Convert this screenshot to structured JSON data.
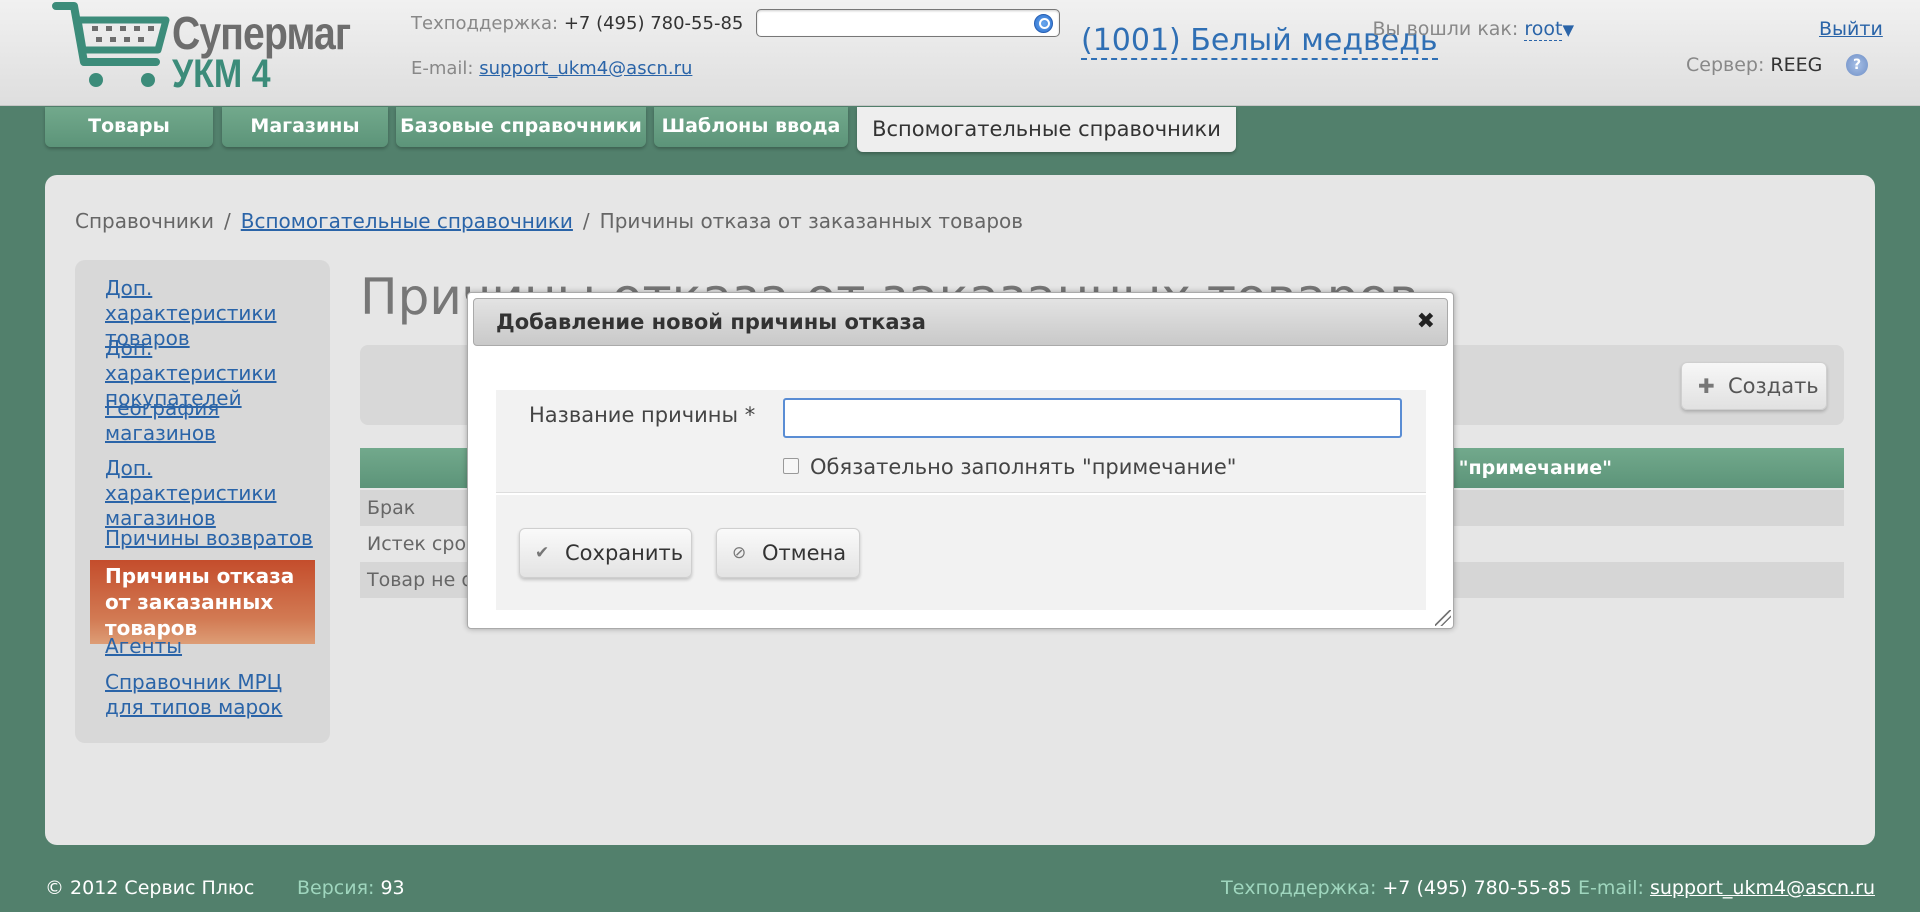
{
  "header": {
    "logo": {
      "line1": "Супермаг",
      "line2": "УКМ 4"
    },
    "support_label": "Техподдержка:",
    "support_phone": "+7 (495) 780-55-85",
    "email_label": "E-mail:",
    "email": "support_ukm4@ascn.ru",
    "search": {
      "value": "",
      "placeholder": ""
    },
    "shop": "(1001) Белый медведь",
    "logged_in_label": "Вы вошли как:",
    "user": "root",
    "logout": "Выйти",
    "server_label": "Сервер:",
    "server": "REEG",
    "help": "?"
  },
  "tabs": [
    {
      "label": "Товары"
    },
    {
      "label": "Магазины"
    },
    {
      "label": "Базовые справочники"
    },
    {
      "label": "Шаблоны ввода"
    },
    {
      "label": "Вспомогательные справочники",
      "active": true
    }
  ],
  "breadcrumb": {
    "root": "Справочники",
    "sep": "/",
    "parent": "Вспомогательные справочники",
    "current": "Причины отказа от заказанных товаров"
  },
  "sidebar": {
    "items": [
      {
        "label": "Доп. характеристики товаров"
      },
      {
        "label": "Доп. характеристики покупателей"
      },
      {
        "label": "География магазинов"
      },
      {
        "label": "Доп. характеристики магазинов"
      },
      {
        "label": "Причины возвратов"
      },
      {
        "label": "Причины отказа от заказанных товаров",
        "active": true
      },
      {
        "label": "Агенты"
      },
      {
        "label": "Справочник МРЦ для типов марок"
      }
    ]
  },
  "main": {
    "title": "Причины отказа от заказанных товаров",
    "create_button": "Создать",
    "grid": {
      "header_visible": "ь \"примечание\"",
      "rows": [
        "Брак",
        "Истек срок",
        "Товар не о"
      ]
    }
  },
  "dialog": {
    "title": "Добавление новой причины отказа",
    "close": "✖",
    "name_label": "Название причины *",
    "name_value": "",
    "checkbox_label": "Обязательно заполнять \"примечание\"",
    "checkbox_checked": false,
    "save": "Сохранить",
    "cancel": "Отмена"
  },
  "footer": {
    "copyright": "© 2012 Сервис Плюс",
    "version_label": "Версия:",
    "version": "93",
    "support_label": "Техподдержка:",
    "support_phone": "+7 (495) 780-55-85",
    "email_label": "E-mail:",
    "email": "support_ukm4@ascn.ru"
  },
  "colors": {
    "background": "#52806c",
    "tab": "#6aa084",
    "active_sidebar": "#c75a36",
    "link": "#2a64a8"
  }
}
